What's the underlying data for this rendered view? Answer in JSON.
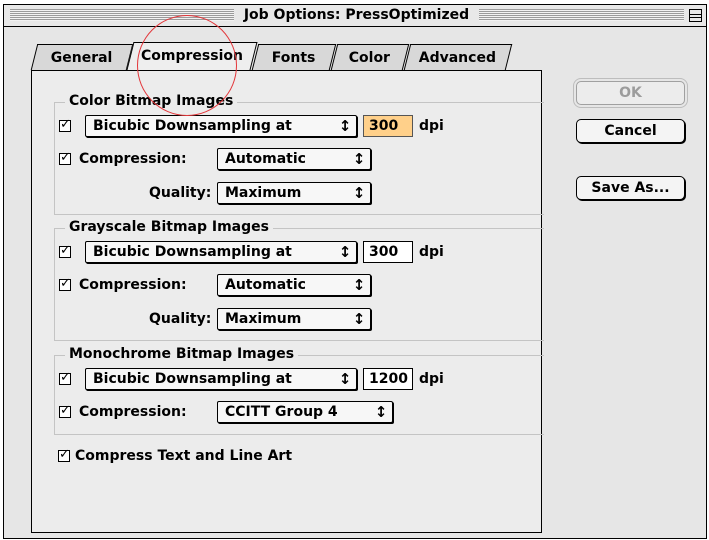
{
  "window": {
    "title": "Job Options: PressOptimized"
  },
  "tabs": [
    {
      "label": "General"
    },
    {
      "label": "Compression"
    },
    {
      "label": "Fonts"
    },
    {
      "label": "Color"
    },
    {
      "label": "Advanced"
    }
  ],
  "active_tab": "Compression",
  "color_group": {
    "title": "Color Bitmap Images",
    "resample_method": "Bicubic Downsampling at",
    "resolution": "300",
    "resolution_unit": "dpi",
    "compression_label": "Compression:",
    "compression_value": "Automatic",
    "quality_label": "Quality:",
    "quality_value": "Maximum"
  },
  "gray_group": {
    "title": "Grayscale Bitmap Images",
    "resample_method": "Bicubic Downsampling at",
    "resolution": "300",
    "resolution_unit": "dpi",
    "compression_label": "Compression:",
    "compression_value": "Automatic",
    "quality_label": "Quality:",
    "quality_value": "Maximum"
  },
  "mono_group": {
    "title": "Monochrome Bitmap Images",
    "resample_method": "Bicubic Downsampling at",
    "resolution": "1200",
    "resolution_unit": "dpi",
    "compression_label": "Compression:",
    "compression_value": "CCITT Group 4"
  },
  "compress_text": {
    "label": "Compress Text and Line Art"
  },
  "buttons": {
    "ok": "OK",
    "cancel": "Cancel",
    "save_as": "Save As..."
  },
  "colors": {
    "focused_field": "#ffd08a",
    "annotation_circle": "#e3373b"
  }
}
